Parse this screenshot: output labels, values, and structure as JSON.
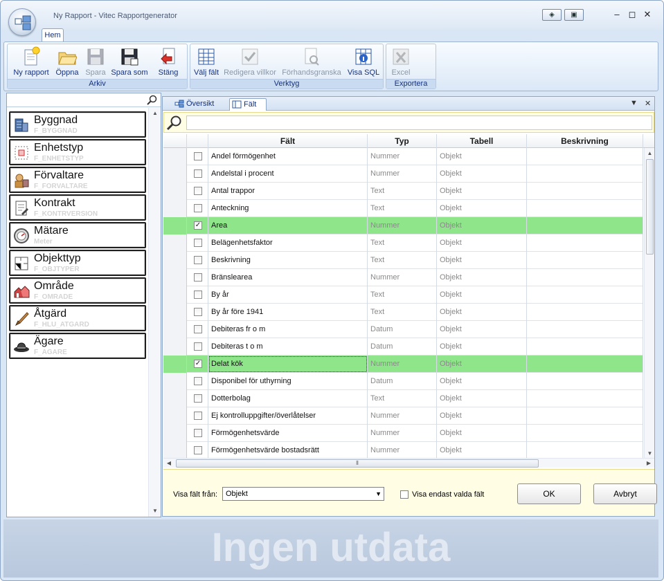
{
  "window": {
    "title": "Ny Rapport - Vitec Rapportgenerator"
  },
  "ribbon": {
    "tab": "Hem",
    "groups": [
      {
        "label": "Arkiv",
        "buttons": [
          {
            "label": "Ny rapport",
            "icon": "new-report-icon",
            "enabled": true
          },
          {
            "label": "Öppna",
            "icon": "folder-open-icon",
            "enabled": true
          },
          {
            "label": "Spara",
            "icon": "save-icon",
            "enabled": false
          },
          {
            "label": "Spara som",
            "icon": "save-as-icon",
            "enabled": true
          },
          {
            "label": "Stäng",
            "icon": "close-report-icon",
            "enabled": true
          }
        ]
      },
      {
        "label": "Verktyg",
        "buttons": [
          {
            "label": "Välj fält",
            "icon": "select-fields-icon",
            "enabled": true
          },
          {
            "label": "Redigera villkor",
            "icon": "edit-conditions-icon",
            "enabled": false
          },
          {
            "label": "Förhandsgranska",
            "icon": "preview-icon",
            "enabled": false
          },
          {
            "label": "Visa SQL",
            "icon": "show-sql-icon",
            "enabled": true
          }
        ]
      },
      {
        "label": "Exportera",
        "buttons": [
          {
            "label": "Excel",
            "icon": "excel-icon",
            "enabled": false
          }
        ]
      }
    ]
  },
  "left_panel": {
    "items": [
      {
        "name": "Byggnad",
        "sub": "F_BYGGNAD",
        "icon": "building-icon"
      },
      {
        "name": "Enhetstyp",
        "sub": "F_ENHETSTYP",
        "icon": "unit-type-icon"
      },
      {
        "name": "Förvaltare",
        "sub": "F_FORVALTARE",
        "icon": "manager-icon"
      },
      {
        "name": "Kontrakt",
        "sub": "F_KONTRVERSION",
        "icon": "contract-icon"
      },
      {
        "name": "Mätare",
        "sub": "Meter",
        "icon": "meter-icon"
      },
      {
        "name": "Objekttyp",
        "sub": "F_OBJTYPER",
        "icon": "object-type-icon"
      },
      {
        "name": "Område",
        "sub": "F_OMRADE",
        "icon": "area-icon"
      },
      {
        "name": "Åtgärd",
        "sub": "F_HLU_ATGARD",
        "icon": "action-icon"
      },
      {
        "name": "Ägare",
        "sub": "F_AGARE",
        "icon": "owner-icon"
      }
    ]
  },
  "main": {
    "tabs": [
      {
        "label": "Översikt",
        "icon": "overview-icon"
      },
      {
        "label": "Fält",
        "icon": "fields-icon"
      }
    ],
    "columns": [
      "Fält",
      "Typ",
      "Tabell",
      "Beskrivning"
    ],
    "rows": [
      {
        "field": "Andel förmögenhet",
        "type": "Nummer",
        "table": "Objekt",
        "desc": "",
        "checked": false
      },
      {
        "field": "Andelstal i procent",
        "type": "Nummer",
        "table": "Objekt",
        "desc": "",
        "checked": false
      },
      {
        "field": "Antal trappor",
        "type": "Text",
        "table": "Objekt",
        "desc": "",
        "checked": false
      },
      {
        "field": "Anteckning",
        "type": "Text",
        "table": "Objekt",
        "desc": "",
        "checked": false
      },
      {
        "field": "Area",
        "type": "Nummer",
        "table": "Objekt",
        "desc": "",
        "checked": true
      },
      {
        "field": "Belägenhetsfaktor",
        "type": "Text",
        "table": "Objekt",
        "desc": "",
        "checked": false
      },
      {
        "field": "Beskrivning",
        "type": "Text",
        "table": "Objekt",
        "desc": "",
        "checked": false
      },
      {
        "field": "Bränslearea",
        "type": "Nummer",
        "table": "Objekt",
        "desc": "",
        "checked": false
      },
      {
        "field": "By år",
        "type": "Text",
        "table": "Objekt",
        "desc": "",
        "checked": false
      },
      {
        "field": "By år före 1941",
        "type": "Text",
        "table": "Objekt",
        "desc": "",
        "checked": false
      },
      {
        "field": "Debiteras fr o m",
        "type": "Datum",
        "table": "Objekt",
        "desc": "",
        "checked": false
      },
      {
        "field": "Debiteras t o m",
        "type": "Datum",
        "table": "Objekt",
        "desc": "",
        "checked": false
      },
      {
        "field": "Delat kök",
        "type": "Nummer",
        "table": "Objekt",
        "desc": "",
        "checked": true
      },
      {
        "field": "Disponibel för uthyrning",
        "type": "Datum",
        "table": "Objekt",
        "desc": "",
        "checked": false
      },
      {
        "field": "Dotterbolag",
        "type": "Text",
        "table": "Objekt",
        "desc": "",
        "checked": false
      },
      {
        "field": "Ej kontrolluppgifter/överlåtelser",
        "type": "Nummer",
        "table": "Objekt",
        "desc": "",
        "checked": false
      },
      {
        "field": "Förmögenhetsvärde",
        "type": "Nummer",
        "table": "Objekt",
        "desc": "",
        "checked": false
      },
      {
        "field": "Förmögenhetsvärde bostadsrätt",
        "type": "Nummer",
        "table": "Objekt",
        "desc": "",
        "checked": false
      }
    ],
    "footer": {
      "label": "Visa fält från:",
      "select_value": "Objekt",
      "only_selected_label": "Visa endast valda fält",
      "only_selected_checked": false,
      "ok": "OK",
      "cancel": "Avbryt"
    }
  },
  "status": {
    "text": "Ingen utdata"
  },
  "colors": {
    "selected_row": "#8fe58a",
    "accent": "#15317e",
    "bar_yellow": "#fffde4"
  }
}
